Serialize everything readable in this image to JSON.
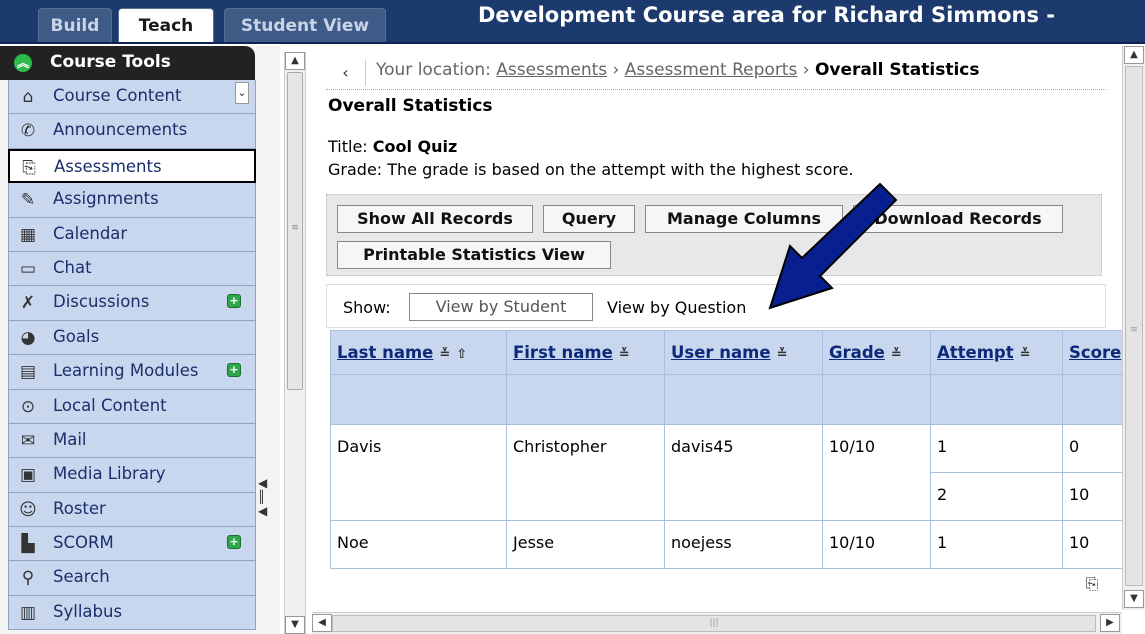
{
  "tabs": [
    {
      "label": "Build",
      "active": false
    },
    {
      "label": "Teach",
      "active": true
    },
    {
      "label": "Student View",
      "active": false
    }
  ],
  "course_title": "Development Course area for Richard Simmons - ",
  "sidebar": {
    "header": "Course Tools",
    "items": [
      {
        "label": "Course Content",
        "icon": "home-icon"
      },
      {
        "label": "Announcements",
        "icon": "megaphone-icon"
      },
      {
        "label": "Assessments",
        "icon": "assessment-icon",
        "selected": true
      },
      {
        "label": "Assignments",
        "icon": "assignment-icon"
      },
      {
        "label": "Calendar",
        "icon": "calendar-icon"
      },
      {
        "label": "Chat",
        "icon": "chat-icon"
      },
      {
        "label": "Discussions",
        "icon": "discussion-icon",
        "badge": "+"
      },
      {
        "label": "Goals",
        "icon": "goals-icon"
      },
      {
        "label": "Learning Modules",
        "icon": "modules-icon",
        "badge": "+"
      },
      {
        "label": "Local Content",
        "icon": "local-content-icon"
      },
      {
        "label": "Mail",
        "icon": "mail-icon"
      },
      {
        "label": "Media Library",
        "icon": "media-icon"
      },
      {
        "label": "Roster",
        "icon": "roster-icon"
      },
      {
        "label": "SCORM",
        "icon": "scorm-icon",
        "badge": "+"
      },
      {
        "label": "Search",
        "icon": "search-icon"
      },
      {
        "label": "Syllabus",
        "icon": "syllabus-icon"
      }
    ]
  },
  "breadcrumb": {
    "prefix": "Your location: ",
    "links": [
      "Assessments",
      "Assessment Reports"
    ],
    "separator": " › ",
    "current": "Overall Statistics"
  },
  "page": {
    "heading": "Overall Statistics",
    "title_label": "Title: ",
    "title_value": "Cool Quiz",
    "grade_text": "Grade: The grade is based on the attempt with the highest score."
  },
  "buttons": {
    "show_all": "Show All Records",
    "query": "Query",
    "manage_columns": "Manage Columns",
    "download": "Download Records",
    "printable": "Printable Statistics View"
  },
  "show_bar": {
    "label": "Show:",
    "by_student": "View by Student",
    "by_question": "View by Question"
  },
  "table": {
    "columns": [
      "Last name",
      "First name",
      "User name",
      "Grade",
      "Attempt",
      "Score"
    ],
    "rows": [
      {
        "last": "Davis",
        "first": "Christopher",
        "user": "davis45",
        "grade": "10/10",
        "attempts": [
          {
            "attempt": "1",
            "score": "0"
          },
          {
            "attempt": "2",
            "score": "10"
          }
        ]
      },
      {
        "last": "Noe",
        "first": "Jesse",
        "user": "noejess",
        "grade": "10/10",
        "attempts": [
          {
            "attempt": "1",
            "score": "10"
          }
        ]
      }
    ]
  },
  "colors": {
    "topbar": "#1d3a6e",
    "sidebar_item": "#c9d7ee",
    "arrow": "#0a1f8f"
  }
}
